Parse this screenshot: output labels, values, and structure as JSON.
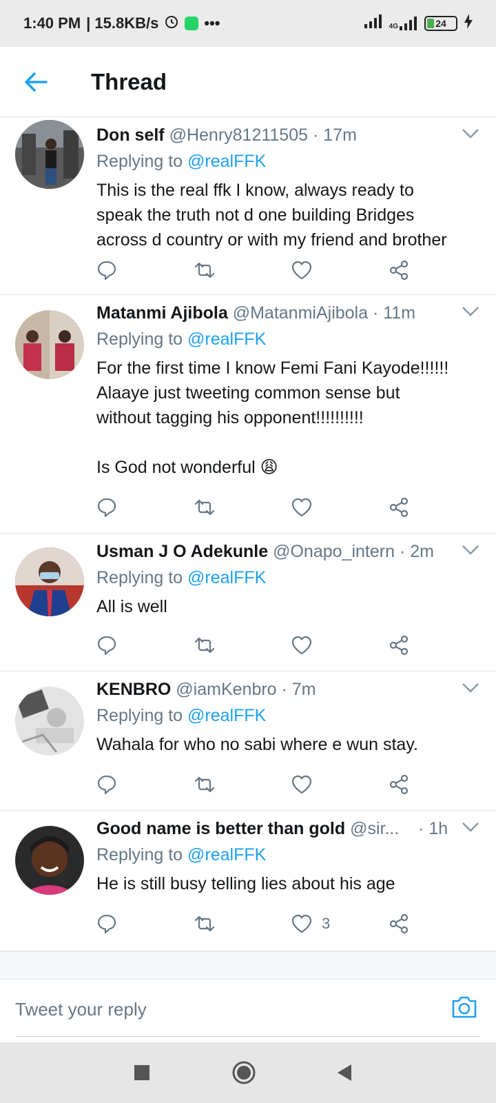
{
  "status_bar": {
    "time": "1:40 PM",
    "speed": "| 15.8KB/s",
    "network": "4G",
    "battery": "24"
  },
  "header": {
    "title": "Thread"
  },
  "tweets": [
    {
      "name": "Don self",
      "handle": "@Henry81211505",
      "time": "· 17m",
      "replying_prefix": "Replying to ",
      "replying_to": "@realFFK",
      "text": "This is the real ffk I know, always ready to\nspeak the truth not d one building Bridges\nacross d country or with my friend and brother",
      "likes": ""
    },
    {
      "name": "Matanmi Ajibola",
      "handle": "@MatanmiAjibola",
      "time": "· 11m",
      "replying_prefix": "Replying to ",
      "replying_to": "@realFFK",
      "text": "For the first time I know Femi Fani Kayode!!!!!!\nAlaaye just tweeting common sense but\nwithout tagging his opponent!!!!!!!!!!\n\nIs God not wonderful 😩",
      "likes": ""
    },
    {
      "name": "Usman J O Adekunle",
      "handle": "@Onapo_intern",
      "time": "· 2m",
      "replying_prefix": "Replying to ",
      "replying_to": "@realFFK",
      "text": "All is well",
      "likes": ""
    },
    {
      "name": "KENBRO",
      "handle": "@iamKenbro",
      "time": "· 7m",
      "replying_prefix": "Replying to ",
      "replying_to": "@realFFK",
      "text": "Wahala for who no sabi where e wun stay.",
      "likes": ""
    },
    {
      "name": "Good name is better than gold",
      "handle": "@sir...",
      "time": "· 1h",
      "replying_prefix": "Replying to ",
      "replying_to": "@realFFK",
      "text": "He is still busy telling lies about his age",
      "likes": "3"
    }
  ],
  "compose": {
    "placeholder": "Tweet your reply"
  },
  "colors": {
    "accent": "#1da1f2",
    "muted": "#657786",
    "divider": "#e1e8ed"
  }
}
